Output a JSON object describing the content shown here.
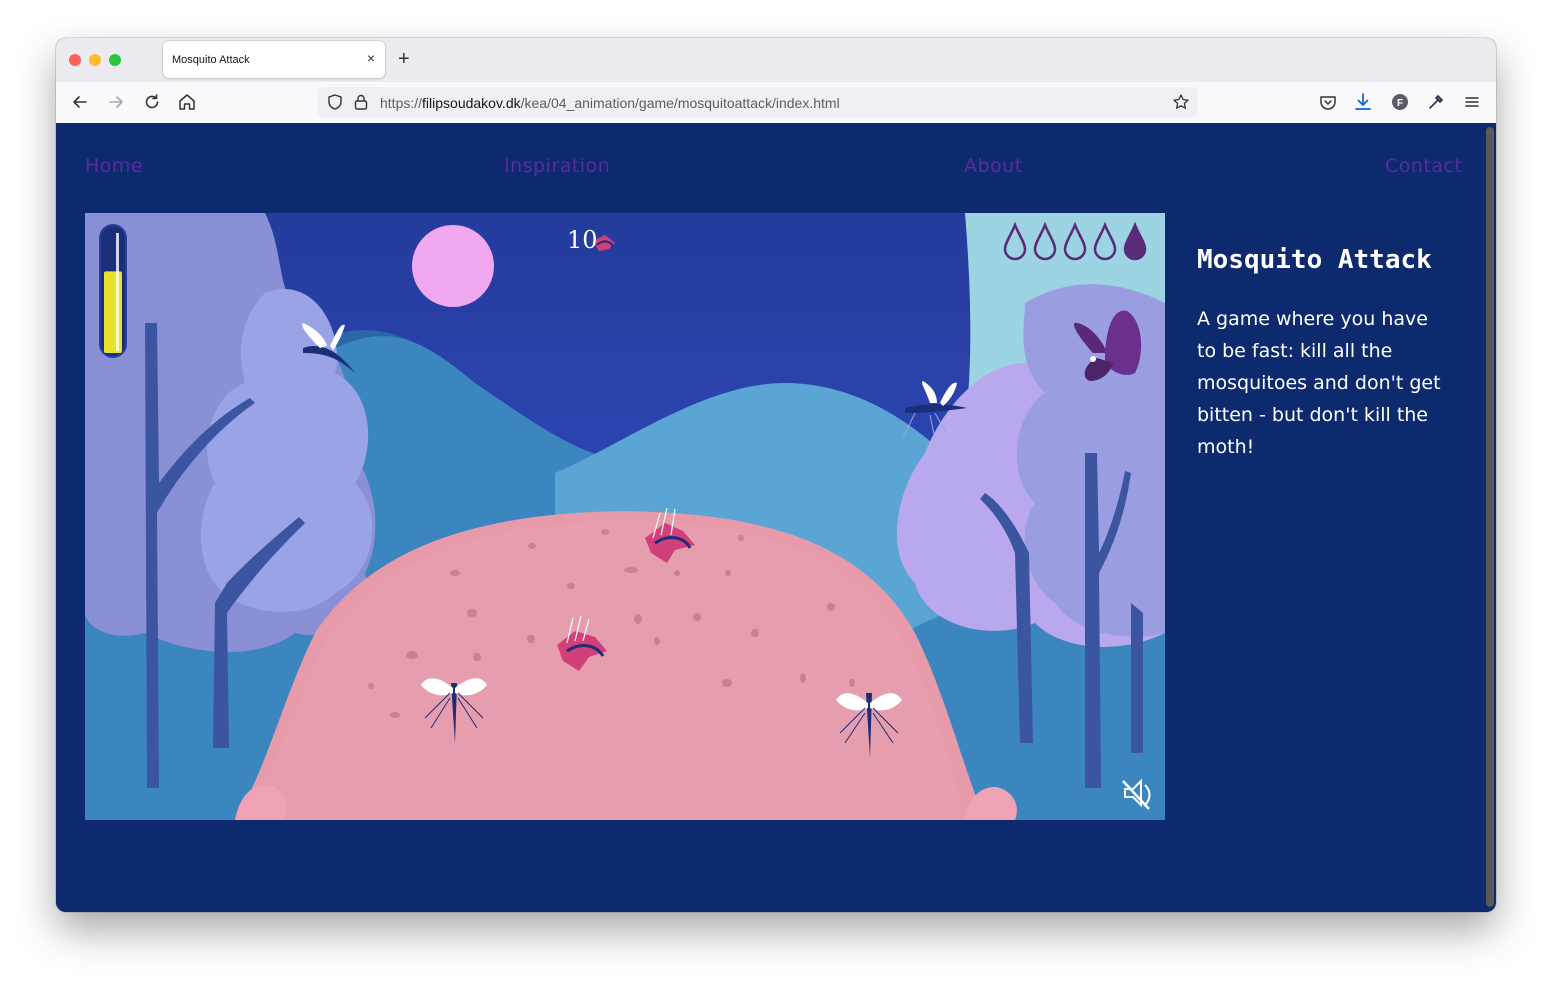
{
  "browser": {
    "tab_title": "Mosquito Attack",
    "tab_close": "×",
    "new_tab": "+",
    "url_protocol": "https://",
    "url_domain": "filipsoudakov.dk",
    "url_path": "/kea/04_animation/game/mosquitoattack/index.html"
  },
  "site_nav": {
    "home": "Home",
    "inspiration": "Inspiration",
    "about": "About",
    "contact": "Contact"
  },
  "game": {
    "score": "10",
    "lives_total": 5,
    "lives_filled": 1,
    "energy_level": 0.68,
    "sound": "muted"
  },
  "info": {
    "title": "Mosquito Attack",
    "description": "A game where you have to be fast: kill all the mosquitoes and don't get bitten - but don't kill the moth!"
  },
  "colors": {
    "page_bg": "#0e2a6e",
    "nav_link": "#5a2b9e",
    "sky_top": "#243c9c",
    "sky_bottom": "#7a5ce8",
    "head": "#e79aa9",
    "energy": "#e9e12e"
  }
}
